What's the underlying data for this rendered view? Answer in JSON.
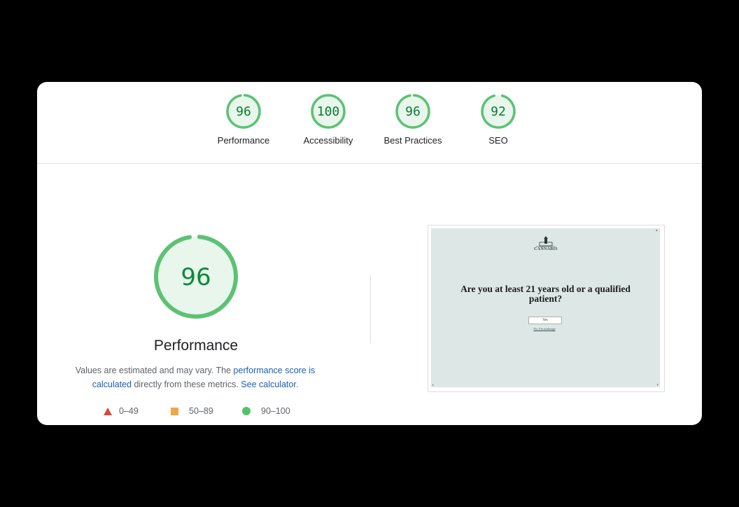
{
  "summary": {
    "gauges": [
      {
        "score": "96",
        "label": "Performance"
      },
      {
        "score": "100",
        "label": "Accessibility"
      },
      {
        "score": "96",
        "label": "Best Practices"
      },
      {
        "score": "92",
        "label": "SEO"
      }
    ]
  },
  "performance": {
    "score": "96",
    "title": "Performance",
    "desc_part1": "Values are estimated and may vary. The ",
    "desc_link1": "performance score is calculated",
    "desc_part2": " directly from these metrics. ",
    "desc_link2": "See calculator",
    "desc_part3": "."
  },
  "legend": {
    "fail": "0–49",
    "average": "50–89",
    "pass": "90–100"
  },
  "screenshot": {
    "logo_text": "CANNABIS",
    "question": "Are you at least 21 years old or a qualified patient?",
    "yes_button": "Yes",
    "no_link": "No, I'm underage"
  },
  "colors": {
    "pass_green": "#0cce6b",
    "gauge_fill": "#e8f6ec",
    "fail_red": "#e0453a",
    "average_orange": "#f1a744",
    "link_blue": "#1a5fb4"
  }
}
